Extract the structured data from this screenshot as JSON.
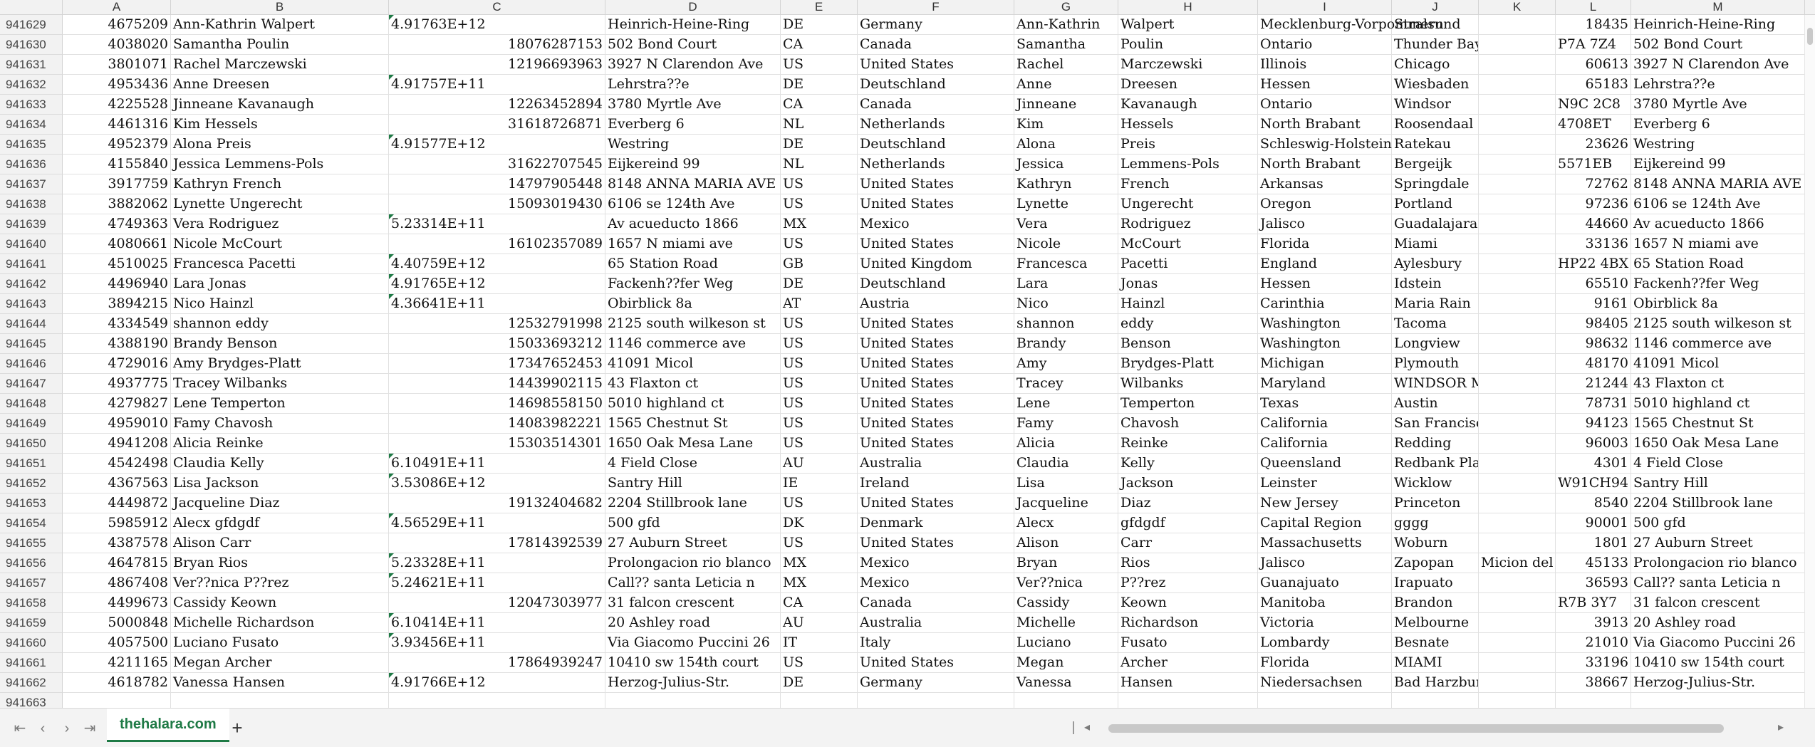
{
  "columns": [
    "A",
    "B",
    "C",
    "D",
    "E",
    "F",
    "G",
    "H",
    "I",
    "J",
    "K",
    "L",
    "M"
  ],
  "rows": [
    {
      "rownum": "941629",
      "a": "4675209",
      "b": "Ann-Kathrin Walpert",
      "c": "4.91763E+12",
      "c_num": false,
      "d": "Heinrich-Heine-Ring",
      "e": "DE",
      "f": "Germany",
      "g": "Ann-Kathrin",
      "h": "Walpert",
      "i": "Mecklenburg-Vorpommern",
      "j": "Stralsund",
      "k": "",
      "l": "18435",
      "l_num": true,
      "m": "Heinrich-Heine-Ring"
    },
    {
      "rownum": "941630",
      "a": "4038020",
      "b": "Samantha Poulin",
      "c": "18076287153",
      "c_num": true,
      "d": "502 Bond Court",
      "e": "CA",
      "f": "Canada",
      "g": "Samantha",
      "h": "Poulin",
      "i": "Ontario",
      "j": "Thunder Bay",
      "k": "",
      "l": "P7A 7Z4",
      "l_num": false,
      "m": "502 Bond Court"
    },
    {
      "rownum": "941631",
      "a": "3801071",
      "b": "Rachel Marczewski",
      "c": "12196693963",
      "c_num": true,
      "d": "3927 N Clarendon Ave",
      "e": "US",
      "f": "United States",
      "g": "Rachel",
      "h": "Marczewski",
      "i": "Illinois",
      "j": "Chicago",
      "k": "",
      "l": "60613",
      "l_num": true,
      "m": "3927 N Clarendon Ave"
    },
    {
      "rownum": "941632",
      "a": "4953436",
      "b": "Anne Dreesen",
      "c": "4.91757E+11",
      "c_num": false,
      "d": "Lehrstra??e",
      "e": "DE",
      "f": "Deutschland",
      "g": "Anne",
      "h": "Dreesen",
      "i": "Hessen",
      "j": "Wiesbaden",
      "k": "",
      "l": "65183",
      "l_num": true,
      "m": "Lehrstra??e"
    },
    {
      "rownum": "941633",
      "a": "4225528",
      "b": "Jinneane Kavanaugh",
      "c": "12263452894",
      "c_num": true,
      "d": "3780 Myrtle Ave",
      "e": "CA",
      "f": "Canada",
      "g": "Jinneane",
      "h": "Kavanaugh",
      "i": "Ontario",
      "j": "Windsor",
      "k": "",
      "l": "N9C 2C8",
      "l_num": false,
      "m": "3780 Myrtle Ave"
    },
    {
      "rownum": "941634",
      "a": "4461316",
      "b": "Kim Hessels",
      "c": "31618726871",
      "c_num": true,
      "d": "Everberg 6",
      "e": "NL",
      "f": "Netherlands",
      "g": "Kim",
      "h": "Hessels",
      "i": "North Brabant",
      "j": "Roosendaal",
      "k": "",
      "l": "4708ET",
      "l_num": false,
      "m": "Everberg 6"
    },
    {
      "rownum": "941635",
      "a": "4952379",
      "b": "Alona Preis",
      "c": "4.91577E+12",
      "c_num": false,
      "d": "Westring",
      "e": "DE",
      "f": "Deutschland",
      "g": "Alona",
      "h": "Preis",
      "i": "Schleswig-Holstein",
      "j": "Ratekau",
      "k": "",
      "l": "23626",
      "l_num": true,
      "m": "Westring"
    },
    {
      "rownum": "941636",
      "a": "4155840",
      "b": "Jessica Lemmens-Pols",
      "c": "31622707545",
      "c_num": true,
      "d": "Eijkereind 99",
      "e": "NL",
      "f": "Netherlands",
      "g": "Jessica",
      "h": "Lemmens-Pols",
      "i": "North Brabant",
      "j": "Bergeijk",
      "k": "",
      "l": "5571EB",
      "l_num": false,
      "m": "Eijkereind 99"
    },
    {
      "rownum": "941637",
      "a": "3917759",
      "b": "Kathryn French",
      "c": "14797905448",
      "c_num": true,
      "d": "8148 ANNA MARIA AVE",
      "e": "US",
      "f": "United States",
      "g": "Kathryn",
      "h": "French",
      "i": "Arkansas",
      "j": "Springdale",
      "k": "",
      "l": "72762",
      "l_num": true,
      "m": "8148 ANNA MARIA AVE"
    },
    {
      "rownum": "941638",
      "a": "3882062",
      "b": "Lynette Ungerecht",
      "c": "15093019430",
      "c_num": true,
      "d": "6106 se 124th Ave",
      "e": "US",
      "f": "United States",
      "g": "Lynette",
      "h": "Ungerecht",
      "i": "Oregon",
      "j": "Portland",
      "k": "",
      "l": "97236",
      "l_num": true,
      "m": "6106 se 124th Ave"
    },
    {
      "rownum": "941639",
      "a": "4749363",
      "b": "Vera Rodriguez",
      "c": "5.23314E+11",
      "c_num": false,
      "d": "Av acueducto 1866",
      "e": "MX",
      "f": "Mexico",
      "g": "Vera",
      "h": "Rodriguez",
      "i": "Jalisco",
      "j": "Guadalajara",
      "k": "",
      "l": "44660",
      "l_num": true,
      "m": "Av acueducto 1866"
    },
    {
      "rownum": "941640",
      "a": "4080661",
      "b": "Nicole McCourt",
      "c": "16102357089",
      "c_num": true,
      "d": "1657 N miami ave",
      "e": "US",
      "f": "United States",
      "g": "Nicole",
      "h": "McCourt",
      "i": "Florida",
      "j": "Miami",
      "k": "",
      "l": "33136",
      "l_num": true,
      "m": "1657 N miami ave"
    },
    {
      "rownum": "941641",
      "a": "4510025",
      "b": "Francesca Pacetti",
      "c": "4.40759E+12",
      "c_num": false,
      "d": "65 Station Road",
      "e": "GB",
      "f": "United Kingdom",
      "g": "Francesca",
      "h": "Pacetti",
      "i": "England",
      "j": "Aylesbury",
      "k": "",
      "l": "HP22 4BX",
      "l_num": false,
      "m": "65 Station Road"
    },
    {
      "rownum": "941642",
      "a": "4496940",
      "b": "Lara Jonas",
      "c": "4.91765E+12",
      "c_num": false,
      "d": "Fackenh??fer Weg",
      "e": "DE",
      "f": "Deutschland",
      "g": "Lara",
      "h": "Jonas",
      "i": "Hessen",
      "j": "Idstein",
      "k": "",
      "l": "65510",
      "l_num": true,
      "m": "Fackenh??fer Weg"
    },
    {
      "rownum": "941643",
      "a": "3894215",
      "b": "Nico Hainzl",
      "c": "4.36641E+11",
      "c_num": false,
      "d": "Obirblick 8a",
      "e": "AT",
      "f": "Austria",
      "g": "Nico",
      "h": "Hainzl",
      "i": "Carinthia",
      "j": "Maria Rain",
      "k": "",
      "l": "9161",
      "l_num": true,
      "m": "Obirblick 8a"
    },
    {
      "rownum": "941644",
      "a": "4334549",
      "b": "shannon eddy",
      "c": "12532791998",
      "c_num": true,
      "d": "2125 south wilkeson st",
      "e": "US",
      "f": "United States",
      "g": "shannon",
      "h": "eddy",
      "i": "Washington",
      "j": "Tacoma",
      "k": "",
      "l": "98405",
      "l_num": true,
      "m": "2125 south wilkeson st"
    },
    {
      "rownum": "941645",
      "a": "4388190",
      "b": "Brandy Benson",
      "c": "15033693212",
      "c_num": true,
      "d": "1146 commerce ave",
      "e": "US",
      "f": "United States",
      "g": "Brandy",
      "h": "Benson",
      "i": "Washington",
      "j": "Longview",
      "k": "",
      "l": "98632",
      "l_num": true,
      "m": "1146 commerce ave"
    },
    {
      "rownum": "941646",
      "a": "4729016",
      "b": "Amy Brydges-Platt",
      "c": "17347652453",
      "c_num": true,
      "d": "41091 Micol",
      "e": "US",
      "f": "United States",
      "g": "Amy",
      "h": "Brydges-Platt",
      "i": "Michigan",
      "j": "Plymouth",
      "k": "",
      "l": "48170",
      "l_num": true,
      "m": "41091 Micol"
    },
    {
      "rownum": "941647",
      "a": "4937775",
      "b": "Tracey Wilbanks",
      "c": "14439902115",
      "c_num": true,
      "d": "43 Flaxton ct",
      "e": "US",
      "f": "United States",
      "g": "Tracey",
      "h": "Wilbanks",
      "i": "Maryland",
      "j": "WINDSOR MILL",
      "k": "",
      "l": "21244",
      "l_num": true,
      "m": "43 Flaxton ct"
    },
    {
      "rownum": "941648",
      "a": "4279827",
      "b": "Lene Temperton",
      "c": "14698558150",
      "c_num": true,
      "d": "5010 highland ct",
      "e": "US",
      "f": "United States",
      "g": "Lene",
      "h": "Temperton",
      "i": "Texas",
      "j": "Austin",
      "k": "",
      "l": "78731",
      "l_num": true,
      "m": "5010 highland ct"
    },
    {
      "rownum": "941649",
      "a": "4959010",
      "b": "Famy Chavosh",
      "c": "14083982221",
      "c_num": true,
      "d": "1565 Chestnut St",
      "e": "US",
      "f": "United States",
      "g": "Famy",
      "h": "Chavosh",
      "i": "California",
      "j": "San Francisco",
      "k": "",
      "l": "94123",
      "l_num": true,
      "m": "1565 Chestnut St"
    },
    {
      "rownum": "941650",
      "a": "4941208",
      "b": "Alicia Reinke",
      "c": "15303514301",
      "c_num": true,
      "d": "1650 Oak Mesa Lane",
      "e": "US",
      "f": "United States",
      "g": "Alicia",
      "h": "Reinke",
      "i": "California",
      "j": "Redding",
      "k": "",
      "l": "96003",
      "l_num": true,
      "m": "1650 Oak Mesa Lane"
    },
    {
      "rownum": "941651",
      "a": "4542498",
      "b": "Claudia Kelly",
      "c": "6.10491E+11",
      "c_num": false,
      "d": "4 Field Close",
      "e": "AU",
      "f": "Australia",
      "g": "Claudia",
      "h": "Kelly",
      "i": "Queensland",
      "j": "Redbank Plains",
      "k": "",
      "l": "4301",
      "l_num": true,
      "m": "4 Field Close"
    },
    {
      "rownum": "941652",
      "a": "4367563",
      "b": "Lisa Jackson",
      "c": "3.53086E+12",
      "c_num": false,
      "d": "Santry Hill",
      "e": "IE",
      "f": "Ireland",
      "g": "Lisa",
      "h": "Jackson",
      "i": "Leinster",
      "j": "Wicklow",
      "k": "",
      "l": "W91CH94",
      "l_num": false,
      "m": "Santry Hill"
    },
    {
      "rownum": "941653",
      "a": "4449872",
      "b": "Jacqueline Diaz",
      "c": "19132404682",
      "c_num": true,
      "d": "2204 Stillbrook lane",
      "e": "US",
      "f": "United States",
      "g": "Jacqueline",
      "h": "Diaz",
      "i": "New Jersey",
      "j": "Princeton",
      "k": "",
      "l": "8540",
      "l_num": true,
      "m": "2204 Stillbrook lane"
    },
    {
      "rownum": "941654",
      "a": "5985912",
      "b": "Alecx gfdgdf",
      "c": "4.56529E+11",
      "c_num": false,
      "d": "500 gfd",
      "e": "DK",
      "f": "Denmark",
      "g": "Alecx",
      "h": "gfdgdf",
      "i": "Capital Region",
      "j": "gggg",
      "k": "",
      "l": "90001",
      "l_num": true,
      "m": "500 gfd"
    },
    {
      "rownum": "941655",
      "a": "4387578",
      "b": "Alison Carr",
      "c": "17814392539",
      "c_num": true,
      "d": "27 Auburn Street",
      "e": "US",
      "f": "United States",
      "g": "Alison",
      "h": "Carr",
      "i": "Massachusetts",
      "j": "Woburn",
      "k": "",
      "l": "1801",
      "l_num": true,
      "m": "27 Auburn Street"
    },
    {
      "rownum": "941656",
      "a": "4647815",
      "b": "Bryan Rios",
      "c": "5.23328E+11",
      "c_num": false,
      "d": "Prolongacion rio blanco",
      "e": "MX",
      "f": "Mexico",
      "g": "Bryan",
      "h": "Rios",
      "i": "Jalisco",
      "j": "Zapopan",
      "k": "Micion del",
      "l": "45133",
      "l_num": true,
      "m": "Prolongacion rio blanco"
    },
    {
      "rownum": "941657",
      "a": "4867408",
      "b": "Ver??nica P??rez",
      "c": "5.24621E+11",
      "c_num": false,
      "d": "Call?? santa Leticia n",
      "e": "MX",
      "f": "Mexico",
      "g": "Ver??nica",
      "h": "P??rez",
      "i": "Guanajuato",
      "j": "Irapuato",
      "k": "",
      "l": "36593",
      "l_num": true,
      "m": "Call?? santa Leticia n"
    },
    {
      "rownum": "941658",
      "a": "4499673",
      "b": "Cassidy Keown",
      "c": "12047303977",
      "c_num": true,
      "d": "31 falcon crescent",
      "e": "CA",
      "f": "Canada",
      "g": "Cassidy",
      "h": "Keown",
      "i": "Manitoba",
      "j": "Brandon",
      "k": "",
      "l": "R7B 3Y7",
      "l_num": false,
      "m": "31 falcon crescent"
    },
    {
      "rownum": "941659",
      "a": "5000848",
      "b": "Michelle Richardson",
      "c": "6.10414E+11",
      "c_num": false,
      "d": "20 Ashley road",
      "e": "AU",
      "f": "Australia",
      "g": "Michelle",
      "h": "Richardson",
      "i": "Victoria",
      "j": "Melbourne",
      "k": "",
      "l": "3913",
      "l_num": true,
      "m": "20 Ashley road"
    },
    {
      "rownum": "941660",
      "a": "4057500",
      "b": "Luciano Fusato",
      "c": "3.93456E+11",
      "c_num": false,
      "d": "Via Giacomo Puccini 26",
      "e": "IT",
      "f": "Italy",
      "g": "Luciano",
      "h": "Fusato",
      "i": "Lombardy",
      "j": "Besnate",
      "k": "",
      "l": "21010",
      "l_num": true,
      "m": "Via Giacomo Puccini 26"
    },
    {
      "rownum": "941661",
      "a": "4211165",
      "b": "Megan Archer",
      "c": "17864939247",
      "c_num": true,
      "d": "10410 sw 154th court",
      "e": "US",
      "f": "United States",
      "g": "Megan",
      "h": "Archer",
      "i": "Florida",
      "j": "MIAMI",
      "k": "",
      "l": "33196",
      "l_num": true,
      "m": "10410 sw 154th court"
    },
    {
      "rownum": "941662",
      "a": "4618782",
      "b": "Vanessa Hansen",
      "c": "4.91766E+12",
      "c_num": false,
      "d": "Herzog-Julius-Str.",
      "e": "DE",
      "f": "Germany",
      "g": "Vanessa",
      "h": "Hansen",
      "i": "Niedersachsen",
      "j": "Bad Harzburg",
      "k": "",
      "l": "38667",
      "l_num": true,
      "m": "Herzog-Julius-Str."
    },
    {
      "rownum": "941663",
      "a": "",
      "b": "",
      "c": "",
      "c_num": true,
      "d": "",
      "e": "",
      "f": "",
      "g": "",
      "h": "",
      "i": "",
      "j": "",
      "k": "",
      "l": "",
      "l_num": true,
      "m": ""
    }
  ],
  "sheet_tab": "thehalara.com",
  "colors": {
    "accent": "#1e7a45",
    "header_bg": "#f2f2f2",
    "grid_line": "#e1e1e1"
  },
  "icons": {
    "nav_first": "first-sheet-icon",
    "nav_prev": "prev-sheet-icon",
    "nav_next": "next-sheet-icon",
    "nav_last": "last-sheet-icon",
    "add_sheet": "plus-icon"
  }
}
